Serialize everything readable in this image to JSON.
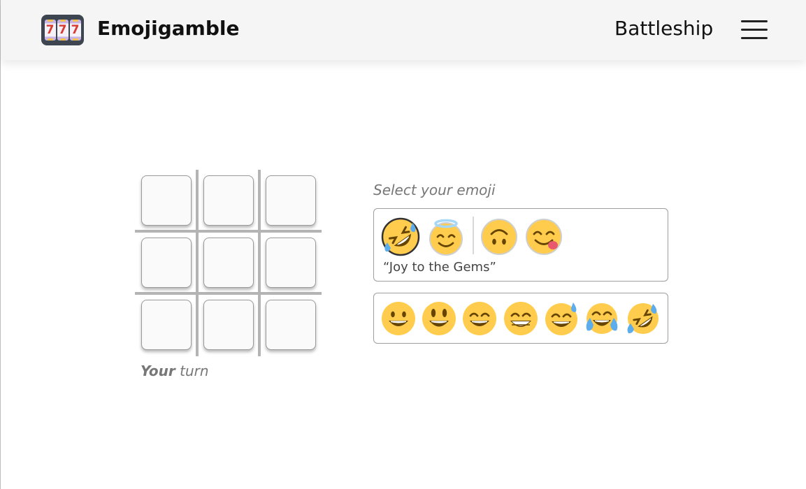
{
  "header": {
    "brand": "Emojigamble",
    "logo_reels": [
      "7",
      "7",
      "7"
    ],
    "nav_link": "Battleship",
    "menu_icon": "hamburger-menu-icon"
  },
  "board": {
    "cells": [
      {
        "value": ""
      },
      {
        "value": ""
      },
      {
        "value": ""
      },
      {
        "value": ""
      },
      {
        "value": ""
      },
      {
        "value": ""
      },
      {
        "value": ""
      },
      {
        "value": ""
      },
      {
        "value": ""
      }
    ],
    "turn_emphasis": "Your",
    "turn_text": " turn"
  },
  "selector": {
    "label": "Select your emoji",
    "set_name": "“Joy to the Gems”",
    "featured": [
      {
        "icon": "rolling-on-floor-laughing-icon",
        "selected": true
      },
      {
        "icon": "smiling-face-with-halo-icon",
        "selected": false
      },
      {
        "icon": "upside-down-face-icon",
        "selected": false
      },
      {
        "icon": "face-savoring-food-icon",
        "selected": false
      }
    ],
    "options": [
      {
        "icon": "grinning-face-icon"
      },
      {
        "icon": "grinning-face-big-eyes-icon"
      },
      {
        "icon": "grinning-face-smiling-eyes-icon"
      },
      {
        "icon": "beaming-face-icon"
      },
      {
        "icon": "grinning-face-with-sweat-icon"
      },
      {
        "icon": "face-with-tears-of-joy-icon"
      },
      {
        "icon": "rolling-on-floor-laughing-icon"
      }
    ]
  },
  "colors": {
    "face": "#ffcc4d",
    "feature": "#664500",
    "tear": "#5dadec",
    "halo": "#a6d7f5",
    "tongue": "#e8596e",
    "reel_digit": "#d93a32"
  }
}
